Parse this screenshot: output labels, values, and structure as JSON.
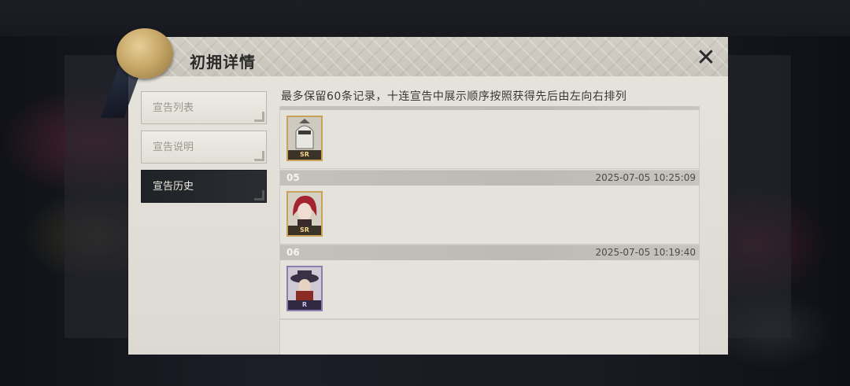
{
  "dialog": {
    "title": "初拥详情",
    "close_label": "✕",
    "notice": "最多保留60条记录，十连宣告中展示顺序按照获得先后由左向右排列"
  },
  "sidebar": {
    "tabs": [
      {
        "label": "宣告列表",
        "active": false
      },
      {
        "label": "宣告说明",
        "active": false
      },
      {
        "label": "宣告历史",
        "active": true
      }
    ]
  },
  "records": [
    {
      "number": "",
      "time": "",
      "cards": [
        {
          "rarity": "SR",
          "icon": "helmet-knight-portrait"
        }
      ]
    },
    {
      "number": "05",
      "time": "2025-07-05 10:25:09",
      "cards": [
        {
          "rarity": "SR",
          "icon": "red-haired-portrait"
        }
      ]
    },
    {
      "number": "06",
      "time": "2025-07-05 10:19:40",
      "cards": [
        {
          "rarity": "R",
          "icon": "hatted-figure-portrait"
        }
      ]
    }
  ],
  "colors": {
    "panel_bg": "#e5e2dc",
    "active_tab_bg": "#1f2226",
    "sr_frame": "#c9a25a",
    "r_frame": "#8c7fb0"
  }
}
